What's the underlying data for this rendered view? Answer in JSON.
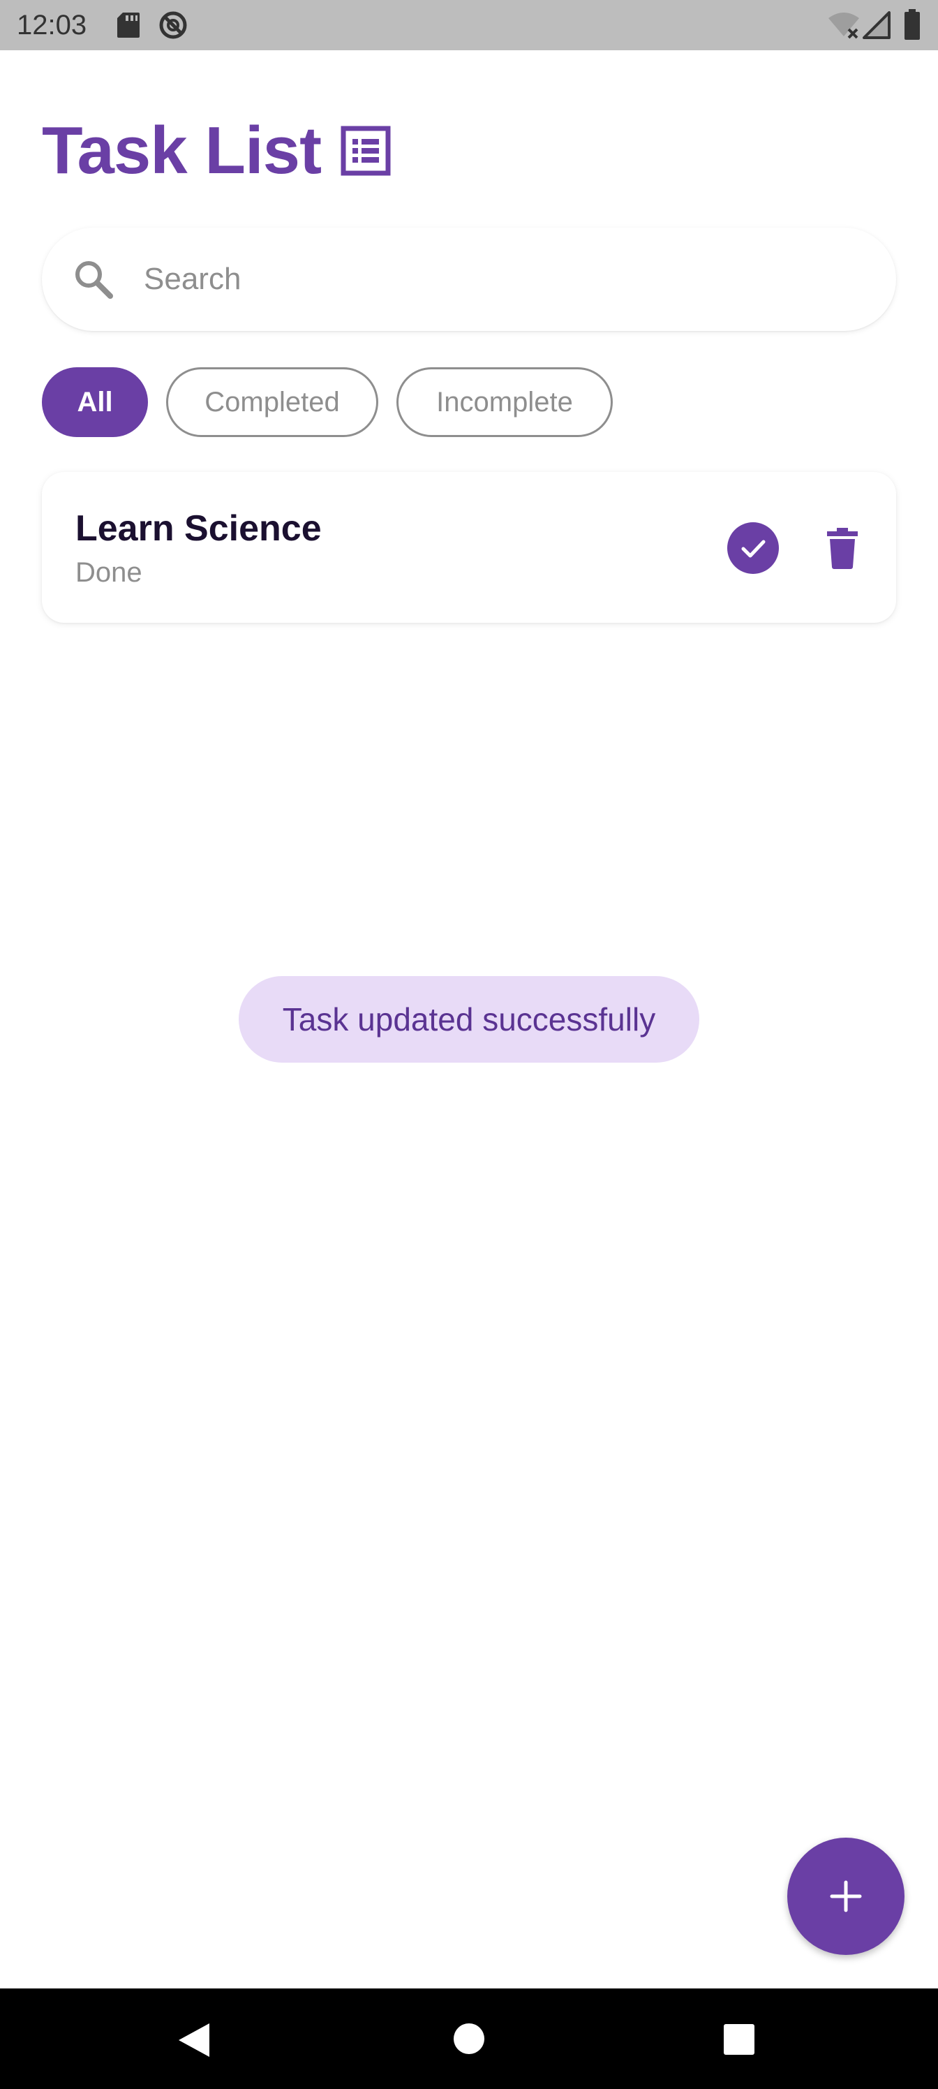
{
  "status_bar": {
    "time": "12:03",
    "icons": [
      "sd-card-icon",
      "sync-blocked-icon",
      "wifi-off-icon",
      "signal-icon",
      "battery-icon"
    ]
  },
  "header": {
    "title": "Task List",
    "icon": "list-icon"
  },
  "search": {
    "placeholder": "Search",
    "value": "",
    "icon": "search-icon"
  },
  "filters": {
    "items": [
      {
        "label": "All",
        "selected": true
      },
      {
        "label": "Completed",
        "selected": false
      },
      {
        "label": "Incomplete",
        "selected": false
      }
    ]
  },
  "tasks": [
    {
      "title": "Learn Science",
      "status": "Done",
      "completed": true
    }
  ],
  "toast": {
    "message": "Task updated successfully"
  },
  "fab": {
    "icon": "plus-icon"
  },
  "navigation": {
    "icons": [
      "back-icon",
      "home-icon",
      "recents-icon"
    ]
  },
  "colors": {
    "accent": "#6a3fa5",
    "toast_bg": "#e8dbf7",
    "toast_text": "#5a3392",
    "status_bar": "#bdbdbd",
    "muted_text": "#8e8e8e"
  }
}
